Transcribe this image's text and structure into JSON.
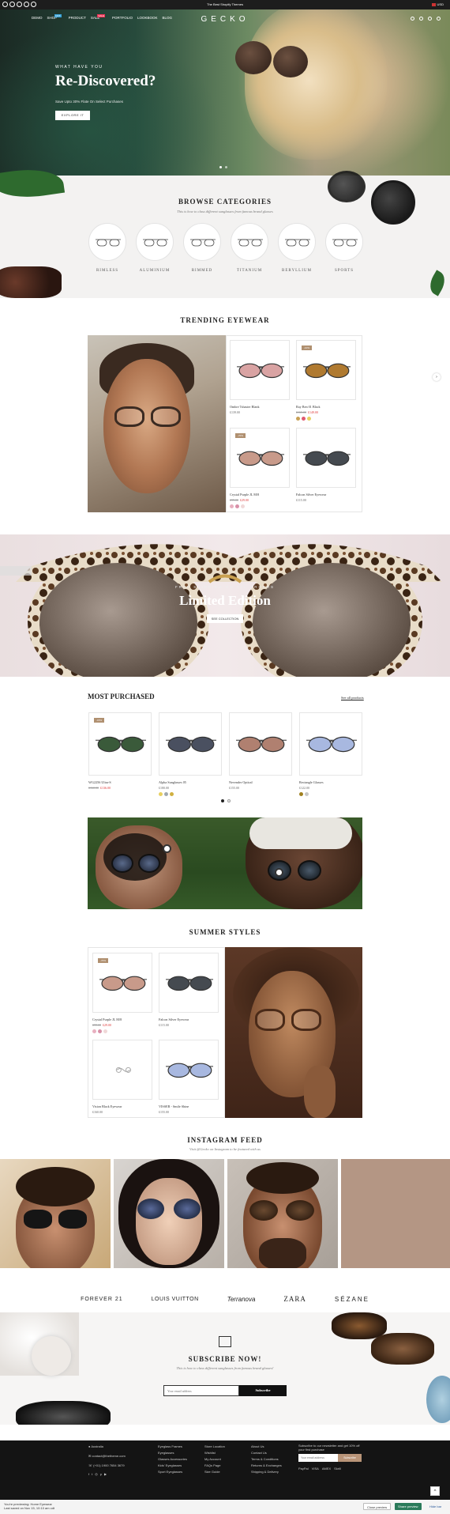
{
  "topbar": {
    "promo": "The Best Shopify Themes",
    "currency": "USD"
  },
  "header": {
    "logo": "GECKO",
    "nav": [
      {
        "label": "DEMO"
      },
      {
        "label": "SHOP",
        "badge": "HOT"
      },
      {
        "label": "PRODUCT"
      },
      {
        "label": "SALE",
        "badge": "SALE"
      },
      {
        "label": "PORTFOLIO"
      },
      {
        "label": "LOOKBOOK"
      },
      {
        "label": "BLOG"
      }
    ],
    "icons": [
      "search-icon",
      "user-icon",
      "wishlist-icon",
      "cart-icon"
    ]
  },
  "hero": {
    "kicker": "WHAT HAVE YOU",
    "title": "Re-Discovered?",
    "subtitle": "Save Upto 30% Flate On Select Purchases",
    "cta": "EXPLORE IT"
  },
  "categories": {
    "title": "BROWSE CATEGORIES",
    "subtitle": "This is how to class different sunglasses from famous brand glasses",
    "items": [
      "RIMLESS",
      "ALUMINIUM",
      "RIMMED",
      "TITANIUM",
      "BERYLLIUM",
      "SPORTS"
    ]
  },
  "trending": {
    "title": "TRENDING EYEWEAR",
    "products": [
      {
        "name": "Ombre Tshaster Blank",
        "price": "£139.00",
        "badge": "",
        "lens": "#d9a3a3",
        "swatches": []
      },
      {
        "name": "Ray Ben 01 Black",
        "old": "£165.00",
        "price": "£149.00",
        "badge": "-10%",
        "lens": "#b07a30",
        "swatches": [
          "#c8a055",
          "#e05a70",
          "#e8d060"
        ]
      },
      {
        "name": "Crystal Purple JL M/8",
        "old": "£99.00",
        "price": "£29.00",
        "badge": "-70%",
        "lens": "#c89a8a",
        "swatches": [
          "#e8b0c0",
          "#d890a8",
          "#f0d8d8"
        ]
      },
      {
        "name": "Falcon Silver Eyewear",
        "price": "£115.00",
        "badge": "",
        "lens": "#454a50",
        "swatches": []
      }
    ]
  },
  "limited": {
    "kicker": "FREE SHIPPING ON ALL ORDERS",
    "title": "Limited Edition",
    "cta": "SEE COLLECTION"
  },
  "most_purchased": {
    "title": "MOST PURCHASED",
    "see_all": "See all products",
    "products": [
      {
        "name": "WG2256 Ultra-S",
        "old": "£160.00",
        "price": "£136.00",
        "badge": "-15%",
        "lens": "#3a5a3a",
        "swatches": []
      },
      {
        "name": "Alpha Sunglasses 05",
        "price": "£180.00",
        "badge": "",
        "lens": "#4a5060",
        "swatches": [
          "#e8d060",
          "#a0a8b0",
          "#d0b040"
        ]
      },
      {
        "name": "Nevender Optical",
        "price": "£155.00",
        "badge": "",
        "lens": "#b08070",
        "swatches": []
      },
      {
        "name": "Rectangle Glasses",
        "price": "£122.00",
        "badge": "",
        "lens": "#a8b8e0",
        "swatches": [
          "#a08020",
          "#c8c8c8"
        ]
      }
    ]
  },
  "summer": {
    "title": "SUMMER STYLES",
    "products": [
      {
        "name": "Crystal Purple JL M/8",
        "old": "£99.00",
        "price": "£29.00",
        "badge": "-70%",
        "lens": "#c89a8a",
        "swatches": [
          "#e8b0c0",
          "#d890a8",
          "#f0d8d8"
        ]
      },
      {
        "name": "Falcon Silver Eyewear",
        "price": "£115.00",
        "badge": "",
        "lens": "#454a50",
        "swatches": []
      },
      {
        "name": "Vision Black Eyewear",
        "price": "£160.00",
        "badge": "",
        "lens": "",
        "swatches": []
      },
      {
        "name": "VISSER - Smile Shine",
        "price": "£155.00",
        "badge": "",
        "lens": "#a8b8e0",
        "swatches": []
      }
    ]
  },
  "instagram": {
    "title": "INSTAGRAM FEED",
    "subtitle": "Visit @Gecko on Instagram to be featured with us"
  },
  "brands": [
    "FOREVER 21",
    "LOUIS VUITTON",
    "Terranova",
    "ZARA",
    "SÉZANE"
  ],
  "subscribe": {
    "title": "SUBSCRIBE NOW!",
    "subtitle": "This is how to class different sunglasses from famous brand glasses!",
    "placeholder": "Your email address",
    "button": "Subscribe"
  },
  "footer": {
    "contact": [
      "Australia",
      "contact@thetheme.com",
      "(+01) 1900 7654 3679"
    ],
    "col1": [
      "Eyeglass Frames",
      "Eyeglasses",
      "Glasses Accessories",
      "Kids' Eyeglasses",
      "Sport Eyeglasses"
    ],
    "col2": [
      "Store Location",
      "Wishlist",
      "My Account",
      "FAQs Page",
      "Size Guide"
    ],
    "col3": [
      "About Us",
      "Contact Us",
      "Terms & Conditions",
      "Returns & Exchanges",
      "Shipping & Delivery"
    ],
    "newsletter": "Subscribe to our newsletter and get 10% off your first purchase",
    "news_placeholder": "Your email address",
    "news_button": "Subscribe",
    "payments": [
      "PayPal",
      "VISA",
      "AMEX",
      "Skrill"
    ]
  },
  "preview_bar": {
    "line1": "You're previewing: Home Eyewear",
    "line2": "Last saved on Nov 15, 10:10 am cdt",
    "close": "Close preview",
    "share": "Share preview",
    "hide": "Hide bar"
  }
}
